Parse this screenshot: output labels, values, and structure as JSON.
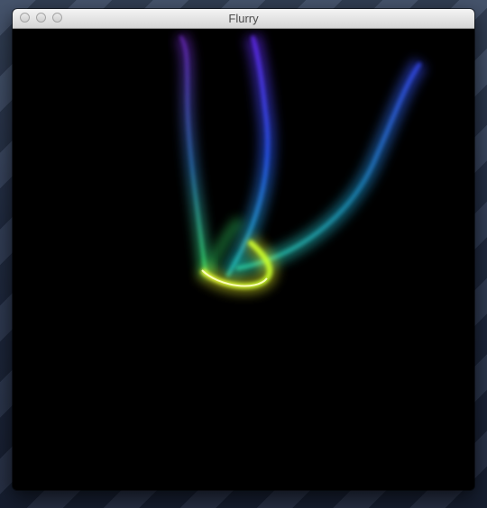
{
  "window": {
    "title": "Flurry",
    "buttons": [
      "close",
      "minimize",
      "zoom"
    ]
  },
  "canvas": {
    "background": "#000000",
    "colors": {
      "yellow": "#f4ff2a",
      "green": "#2dff84",
      "cyan": "#1fb6c8",
      "blue": "#2d5cff",
      "purple": "#8a3cff"
    }
  }
}
